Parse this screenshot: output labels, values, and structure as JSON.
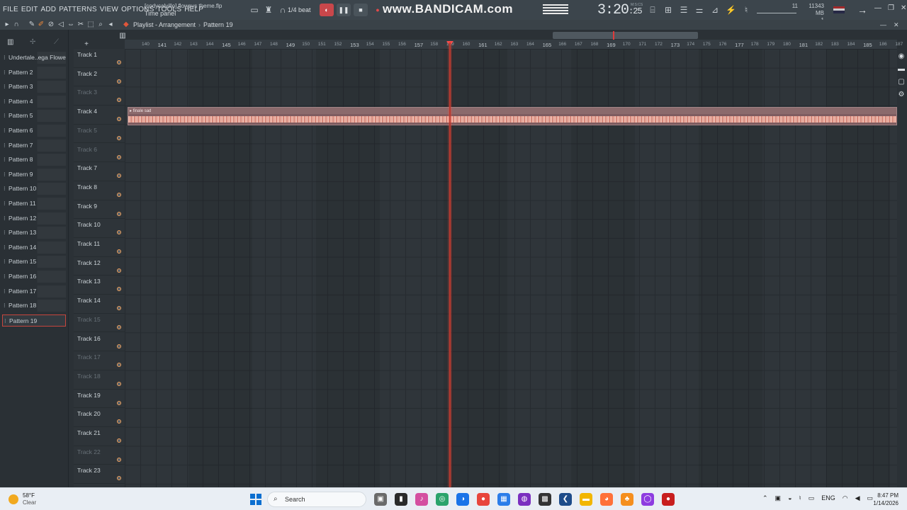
{
  "menu": [
    "FILE",
    "EDIT",
    "ADD",
    "PATTERNS",
    "VIEW",
    "OPTIONS",
    "TOOLS",
    "HELP"
  ],
  "hint": {
    "file": "[codycalvillo] floweys theme.flp",
    "panel": "Time panel"
  },
  "snap": "1/4 beat",
  "watermark": "www.BANDICAM.com",
  "time": {
    "main": "3:20",
    "sub": ":25",
    "label": "M:S:CS"
  },
  "cpu": {
    "value": "11"
  },
  "memory": {
    "value": "11343 MB",
    "sub": "1"
  },
  "breadcrumb": {
    "window": "Playlist - Arrangement",
    "pattern": "Pattern 19"
  },
  "patterns": [
    "Undertale..ega Flowey)",
    "Pattern 2",
    "Pattern 3",
    "Pattern 4",
    "Pattern 5",
    "Pattern 6",
    "Pattern 7",
    "Pattern 8",
    "Pattern 9",
    "Pattern 10",
    "Pattern 11",
    "Pattern 12",
    "Pattern 13",
    "Pattern 14",
    "Pattern 15",
    "Pattern 16",
    "Pattern 17",
    "Pattern 18",
    "Pattern 19"
  ],
  "selected_pattern_index": 18,
  "tracks": [
    {
      "name": "Track 1",
      "dim": false
    },
    {
      "name": "Track 2",
      "dim": false
    },
    {
      "name": "Track 3",
      "dim": true
    },
    {
      "name": "Track 4",
      "dim": false
    },
    {
      "name": "Track 5",
      "dim": true
    },
    {
      "name": "Track 6",
      "dim": true
    },
    {
      "name": "Track 7",
      "dim": false
    },
    {
      "name": "Track 8",
      "dim": false
    },
    {
      "name": "Track 9",
      "dim": false
    },
    {
      "name": "Track 10",
      "dim": false
    },
    {
      "name": "Track 11",
      "dim": false
    },
    {
      "name": "Track 12",
      "dim": false
    },
    {
      "name": "Track 13",
      "dim": false
    },
    {
      "name": "Track 14",
      "dim": false
    },
    {
      "name": "Track 15",
      "dim": true
    },
    {
      "name": "Track 16",
      "dim": false
    },
    {
      "name": "Track 17",
      "dim": true
    },
    {
      "name": "Track 18",
      "dim": true
    },
    {
      "name": "Track 19",
      "dim": false
    },
    {
      "name": "Track 20",
      "dim": false
    },
    {
      "name": "Track 21",
      "dim": false
    },
    {
      "name": "Track 22",
      "dim": true
    },
    {
      "name": "Track 23",
      "dim": false
    }
  ],
  "ruler_ticks": [
    "140",
    "141",
    "142",
    "143",
    "144",
    "145",
    "146",
    "147",
    "148",
    "149",
    "150",
    "151",
    "152",
    "153",
    "154",
    "155",
    "156",
    "157",
    "158",
    "159",
    "160",
    "161",
    "162",
    "163",
    "164",
    "165",
    "166",
    "167",
    "168",
    "169",
    "170",
    "171",
    "172",
    "173",
    "174",
    "175",
    "176",
    "177",
    "178",
    "179",
    "180",
    "181",
    "182",
    "183",
    "184",
    "185",
    "186",
    "187"
  ],
  "clip": {
    "title": "finale sad"
  },
  "taskbar": {
    "weather_temp": "58°F",
    "weather_cond": "Clear",
    "search_placeholder": "Search",
    "lang": "ENG",
    "time": "8:47 PM",
    "date": "1/14/2026"
  },
  "colors": {
    "playhead": "#b6392f",
    "clip": "#8b6a6c",
    "selected_border": "#c6463e"
  }
}
